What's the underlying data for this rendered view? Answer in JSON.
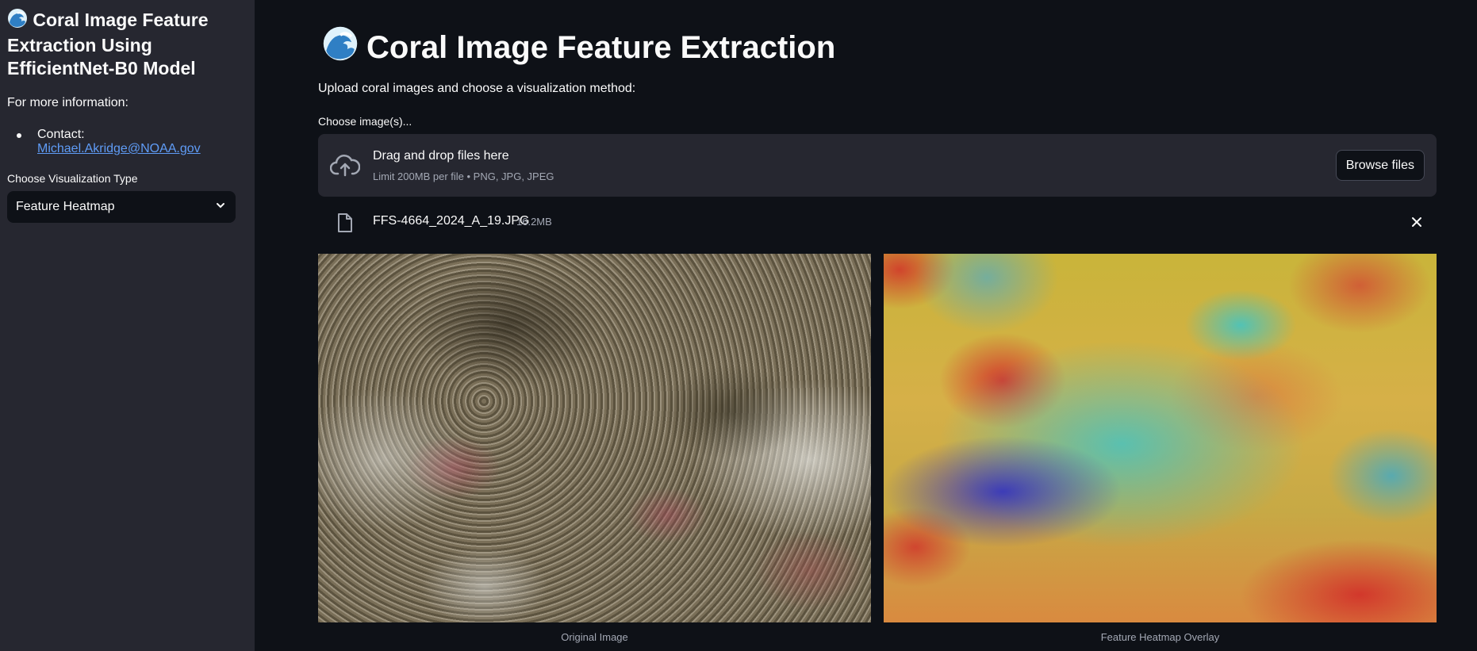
{
  "sidebar": {
    "title": "Coral Image Feature Extraction Using EfficientNet-B0 Model",
    "info": "For more information:",
    "contact_prefix": "Contact: ",
    "contact_email": "Michael.Akridge@NOAA.gov",
    "viz_label": "Choose Visualization Type",
    "viz_selected": "Feature Heatmap"
  },
  "main": {
    "title": "Coral Image Feature Extraction",
    "subtitle": "Upload coral images and choose a visualization method:",
    "upload_label": "Choose image(s)...",
    "dropzone": {
      "main_text": "Drag and drop files here",
      "limit_text": "Limit 200MB per file • PNG, JPG, JPEG",
      "browse_label": "Browse files"
    },
    "file": {
      "name": "FFS-4664_2024_A_19.JPG",
      "size": "16.2MB"
    },
    "captions": {
      "original": "Original Image",
      "heatmap": "Feature Heatmap Overlay"
    }
  },
  "icons": {
    "title_icon": "wave-icon",
    "upload": "cloud-upload-icon",
    "file": "file-icon",
    "close": "close-icon",
    "dropdown": "chevron-down-icon"
  },
  "colors": {
    "background": "#0e1117",
    "sidebar": "#262730",
    "link": "#5f9cf6",
    "muted": "#a3a8b4"
  }
}
